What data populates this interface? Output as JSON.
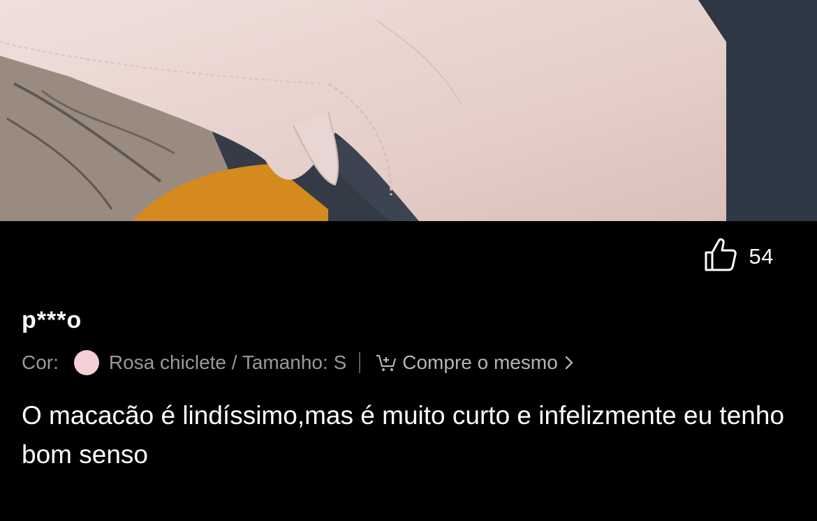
{
  "review": {
    "likes": "54",
    "username": "p***o",
    "variant": {
      "color_label": "Cor:",
      "swatch_color": "#f6cfd6",
      "color_and_size": "Rosa chiclete / Tamanho: S"
    },
    "buy_same_label": "Compre o mesmo",
    "text": "O macacão é lindíssimo,mas é muito curto e infelizmente eu tenho bom senso"
  },
  "icons": {
    "like": "thumbs-up-icon",
    "cart": "add-to-cart-icon",
    "chevron": "chevron-right-icon"
  }
}
